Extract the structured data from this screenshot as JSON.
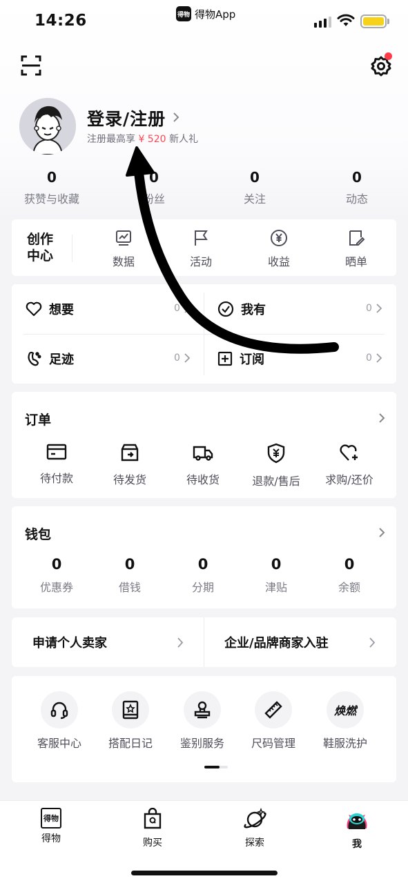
{
  "status_bar": {
    "time": "14:26",
    "app_name": "得物App",
    "app_logo_text": "得物"
  },
  "header": {
    "scan_icon": "scan-icon",
    "settings_icon": "gear-icon",
    "has_notification": true
  },
  "profile": {
    "title": "登录/注册",
    "subtitle_prefix": "注册最高享",
    "subtitle_amount": "¥ 520",
    "subtitle_suffix": "新人礼"
  },
  "stats": [
    {
      "value": "0",
      "label": "获赞与收藏"
    },
    {
      "value": "0",
      "label": "粉丝"
    },
    {
      "value": "0",
      "label": "关注"
    },
    {
      "value": "0",
      "label": "动态"
    }
  ],
  "creation_center": {
    "title": "创作中心",
    "items": [
      {
        "label": "数据",
        "icon": "chart-icon"
      },
      {
        "label": "活动",
        "icon": "flag-icon"
      },
      {
        "label": "收益",
        "icon": "yuan-icon"
      },
      {
        "label": "晒单",
        "icon": "edit-icon"
      }
    ]
  },
  "collections": {
    "want": {
      "label": "想要",
      "count": "0"
    },
    "have": {
      "label": "我有",
      "count": "0"
    },
    "footprint": {
      "label": "足迹",
      "count": "0"
    },
    "subscribe": {
      "label": "订阅",
      "count": "0"
    }
  },
  "orders": {
    "title": "订单",
    "items": [
      {
        "label": "待付款",
        "icon": "card-icon"
      },
      {
        "label": "待发货",
        "icon": "box-icon"
      },
      {
        "label": "待收货",
        "icon": "truck-icon"
      },
      {
        "label": "退款/售后",
        "icon": "shield-yuan-icon"
      },
      {
        "label": "求购/还价",
        "icon": "heart-plus-icon"
      }
    ]
  },
  "wallet": {
    "title": "钱包",
    "items": [
      {
        "value": "0",
        "label": "优惠券"
      },
      {
        "value": "0",
        "label": "借钱"
      },
      {
        "value": "0",
        "label": "分期"
      },
      {
        "value": "0",
        "label": "津贴"
      },
      {
        "value": "0",
        "label": "余额"
      }
    ]
  },
  "seller": {
    "personal": "申请个人卖家",
    "business": "企业/品牌商家入驻"
  },
  "services": [
    {
      "label": "客服中心",
      "icon": "headset-icon"
    },
    {
      "label": "搭配日记",
      "icon": "diary-icon"
    },
    {
      "label": "鉴别服务",
      "icon": "stamp-icon"
    },
    {
      "label": "尺码管理",
      "icon": "ruler-icon"
    },
    {
      "label": "鞋服洗护",
      "icon": "wash-logo-icon",
      "glyph": "焕燃"
    }
  ],
  "tabbar": [
    {
      "label": "得物",
      "icon": "dewu-logo-icon",
      "glyph": "得物"
    },
    {
      "label": "购买",
      "icon": "shopping-bag-icon"
    },
    {
      "label": "探索",
      "icon": "planet-icon"
    },
    {
      "label": "我",
      "icon": "mascot-icon",
      "active": true
    }
  ],
  "colors": {
    "accent_red": "#ff4655",
    "text": "#14151a",
    "muted": "#7a7b85",
    "background": "#f4f4f7"
  }
}
